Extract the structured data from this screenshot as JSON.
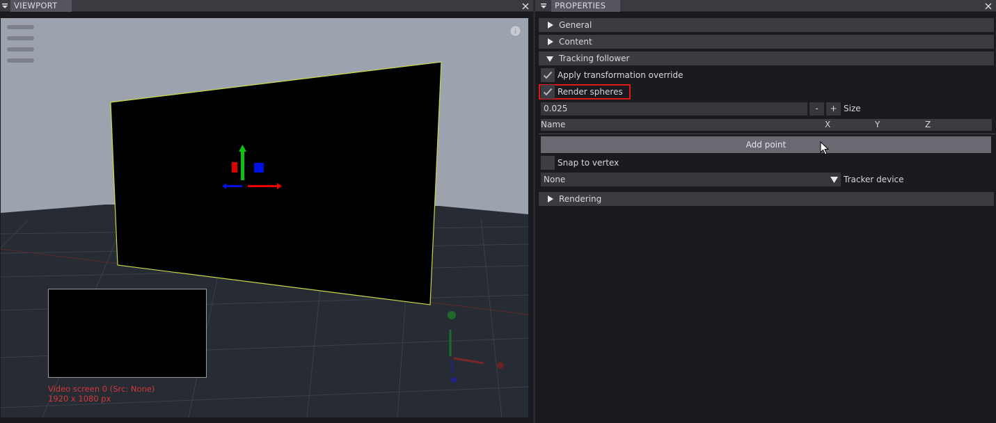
{
  "viewport": {
    "tab_label": "VIEWPORT",
    "video_caption": {
      "title": "Video screen 0 (Src: None)",
      "size": "1920 x 1080 px"
    },
    "icons": [
      "menu-icon",
      "close-icon",
      "hamburger-icon",
      "info-icon"
    ]
  },
  "properties": {
    "tab_label": "PROPERTIES",
    "sections": {
      "general": "General",
      "content": "Content",
      "tracking_follower": "Tracking follower",
      "rendering": "Rendering"
    },
    "tracking_follower": {
      "apply_transformation_override": {
        "label": "Apply transformation override",
        "checked": true
      },
      "render_spheres": {
        "label": "Render spheres",
        "checked": true
      },
      "size": {
        "value": "0.025",
        "minus": "-",
        "plus": "+",
        "label": "Size"
      },
      "points_table": {
        "columns": [
          "Name",
          "X",
          "Y",
          "Z"
        ]
      },
      "add_point_label": "Add point",
      "snap_to_vertex": {
        "label": "Snap to vertex",
        "checked": false
      },
      "tracker_device": {
        "value": "None",
        "label": "Tracker device"
      }
    }
  },
  "colors": {
    "background": "#1b1a1f",
    "header": "#3b3b42",
    "highlight_border": "#e01818",
    "caption_text": "#d23a3a",
    "screen_edge": "#c8d84a"
  }
}
